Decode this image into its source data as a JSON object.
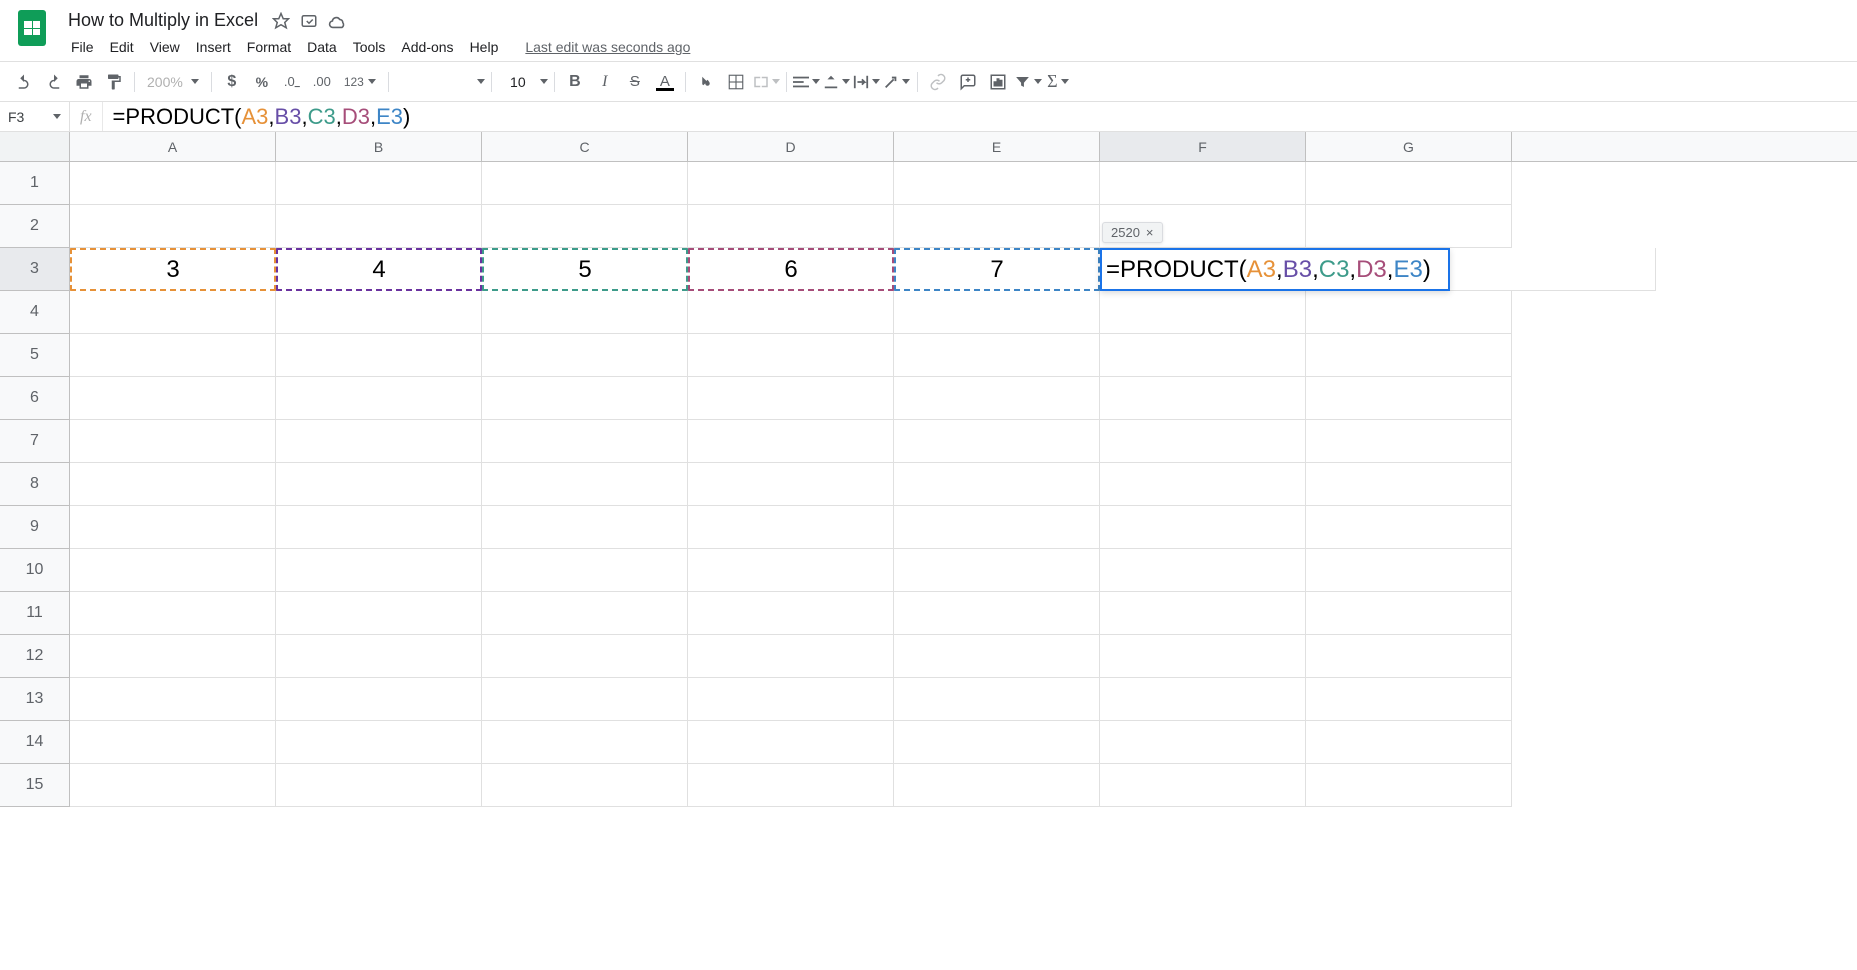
{
  "doc": {
    "title": "How to Multiply in Excel",
    "lastEdit": "Last edit was seconds ago"
  },
  "menu": {
    "file": "File",
    "edit": "Edit",
    "view": "View",
    "insert": "Insert",
    "format": "Format",
    "data": "Data",
    "tools": "Tools",
    "addons": "Add-ons",
    "help": "Help"
  },
  "toolbar": {
    "zoom": "200%",
    "moreFormats": "123",
    "fontSize": "10"
  },
  "nameBox": "F3",
  "formula": {
    "prefix": "=PRODUCT(",
    "a": "A3",
    "b": "B3",
    "c": "C3",
    "d": "D3",
    "e": "E3",
    "suffix": ")",
    "sep": ","
  },
  "hint": {
    "value": "2520"
  },
  "columns": [
    "A",
    "B",
    "C",
    "D",
    "E",
    "F",
    "G"
  ],
  "rows": [
    "1",
    "2",
    "3",
    "4",
    "5",
    "6",
    "7",
    "8",
    "9",
    "10",
    "11",
    "12",
    "13",
    "14",
    "15"
  ],
  "cells": {
    "A3": "3",
    "B3": "4",
    "C3": "5",
    "D3": "6",
    "E3": "7"
  }
}
